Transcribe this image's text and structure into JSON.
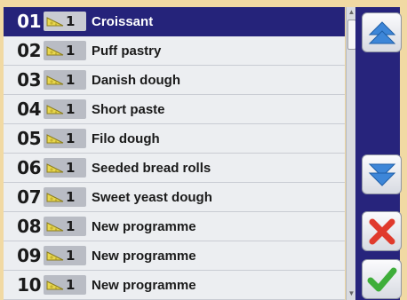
{
  "programmes": [
    {
      "number": "01",
      "level": "1",
      "name": "Croissant",
      "selected": true
    },
    {
      "number": "02",
      "level": "1",
      "name": "Puff pastry"
    },
    {
      "number": "03",
      "level": "1",
      "name": "Danish dough"
    },
    {
      "number": "04",
      "level": "1",
      "name": "Short paste"
    },
    {
      "number": "05",
      "level": "1",
      "name": "Filo dough"
    },
    {
      "number": "06",
      "level": "1",
      "name": "Seeded bread rolls"
    },
    {
      "number": "07",
      "level": "1",
      "name": "Sweet yeast dough"
    },
    {
      "number": "08",
      "level": "1",
      "name": "New programme"
    },
    {
      "number": "09",
      "level": "1",
      "name": "New programme"
    },
    {
      "number": "10",
      "level": "1",
      "name": "New programme"
    }
  ],
  "colors": {
    "background": "#f1d9a3",
    "selected_row": "#25237a",
    "side_panel": "#27247c",
    "up_down_arrow": "#3d86d8",
    "cancel": "#e03a2c",
    "confirm": "#3fae3a"
  },
  "icons": {
    "row_tag": "cheese-wedge-icon",
    "scroll_up": "arrow-up-icon",
    "scroll_down": "arrow-down-icon",
    "cancel": "close-x-icon",
    "confirm": "checkmark-icon"
  }
}
